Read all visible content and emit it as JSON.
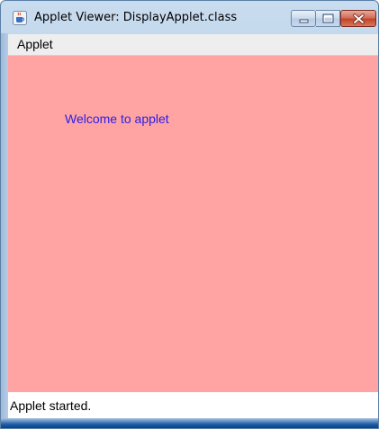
{
  "window": {
    "title": "Applet Viewer: DisplayApplet.class",
    "icon": "java-cup-icon",
    "controls": [
      "minimize-icon",
      "maximize-icon",
      "close-icon"
    ]
  },
  "menubar": {
    "items": [
      {
        "label": "Applet"
      }
    ]
  },
  "applet": {
    "message": "Welcome to applet",
    "background_color": "#ffa3a3",
    "text_color": "#2a1ee8"
  },
  "status": {
    "text": "Applet started."
  }
}
